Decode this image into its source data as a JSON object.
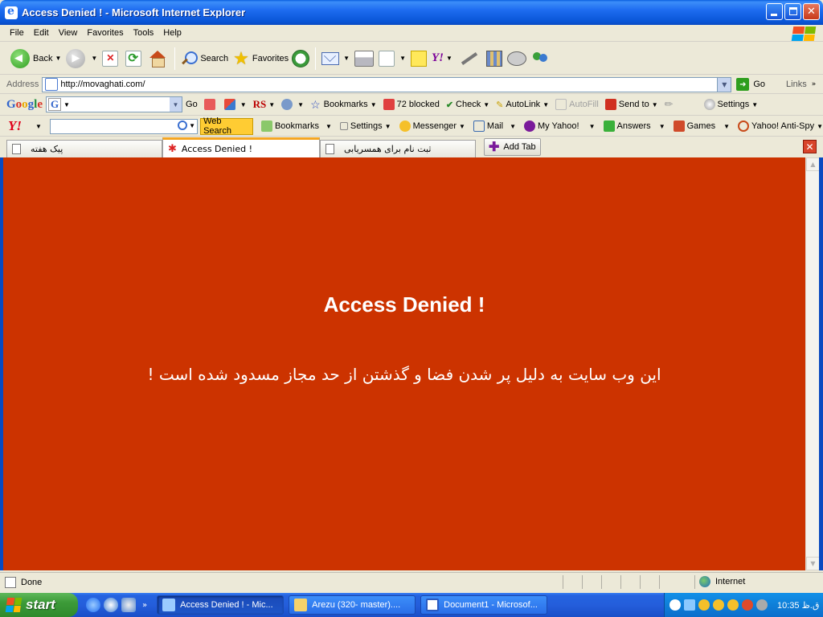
{
  "window": {
    "title": "Access Denied ! - Microsoft Internet Explorer"
  },
  "menu": [
    "File",
    "Edit",
    "View",
    "Favorites",
    "Tools",
    "Help"
  ],
  "toolbar": {
    "back_label": "Back",
    "search_label": "Search",
    "favorites_label": "Favorites"
  },
  "address": {
    "label": "Address",
    "url": "http://movaghati.com/",
    "go_label": "Go",
    "links_label": "Links"
  },
  "google_toolbar": {
    "go_label": "Go",
    "bookmarks_label": "Bookmarks",
    "blocked_label": "72 blocked",
    "check_label": "Check",
    "autolink_label": "AutoLink",
    "autofill_label": "AutoFill",
    "sendto_label": "Send to",
    "settings_label": "Settings",
    "rs_label": "RS"
  },
  "yahoo_toolbar": {
    "websearch_label": "Web Search",
    "bookmarks_label": "Bookmarks",
    "settings_label": "Settings",
    "messenger_label": "Messenger",
    "mail_label": "Mail",
    "myyahoo_label": "My Yahoo!",
    "answers_label": "Answers",
    "games_label": "Games",
    "antispy_label": "Yahoo! Anti-Spy"
  },
  "tabs": [
    {
      "label": "پیک هفته"
    },
    {
      "label": "Access Denied !"
    },
    {
      "label": "ثبت نام برای همسریابی"
    }
  ],
  "add_tab_label": "Add Tab",
  "page": {
    "heading": "Access Denied !",
    "message": "این وب سایت به دلیل پر شدن فضا و گذشتن از حد مجاز مسدود شده است !"
  },
  "status": {
    "text": "Done",
    "zone": "Internet"
  },
  "taskbar": {
    "start_label": "start",
    "tasks": [
      {
        "label": "Access Denied ! - Mic..."
      },
      {
        "label": "Arezu (320- master)...."
      },
      {
        "label": "Document1 - Microsof..."
      }
    ],
    "clock": "10:35 ق.ظ"
  },
  "colors": {
    "page_background": "#CC3300",
    "page_text": "#FFFFFF",
    "active_tab_accent": "#F5A623"
  }
}
